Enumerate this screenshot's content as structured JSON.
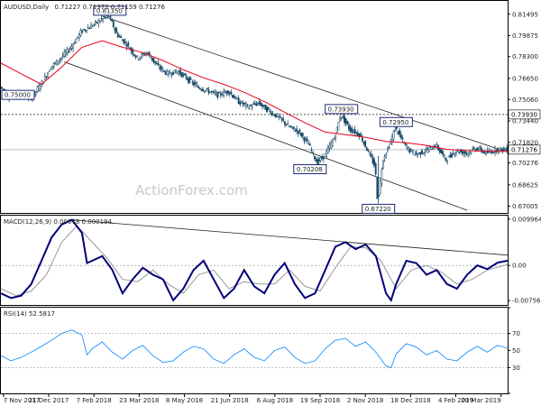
{
  "chart_data": [
    {
      "type": "candlestick",
      "panel": "price",
      "title": "AUDUSD,Daily",
      "ohlc_header": "0.71227 0.71372 0.71159 0.71276",
      "ylim": [
        0.665,
        0.825
      ],
      "y_ticks": [
        "0.81495",
        "0.79875",
        "0.78300",
        "0.76650",
        "0.75060",
        "0.73440",
        "0.71820",
        "0.70276",
        "0.68625",
        "0.67005"
      ],
      "y_tick_values": [
        0.81495,
        0.79875,
        0.783,
        0.7665,
        0.7506,
        0.7344,
        0.7182,
        0.70276,
        0.68625,
        0.67005
      ],
      "current_price": "0.71276",
      "current_price_value": 0.71276,
      "level_price": "0.73930",
      "level_price_value": 0.7393,
      "annotations": [
        {
          "text": "0.81350",
          "t": 0.215,
          "v": 0.8135
        },
        {
          "text": "0.75000",
          "t": 0.02,
          "v": 0.75
        },
        {
          "text": "0.73930",
          "t": 0.672,
          "v": 0.7393
        },
        {
          "text": "0.72950",
          "t": 0.78,
          "v": 0.7295
        },
        {
          "text": "0.70208",
          "t": 0.61,
          "v": 0.70208
        },
        {
          "text": "0.67220",
          "t": 0.745,
          "v": 0.6722
        }
      ],
      "price_path": [
        [
          0.0,
          0.76
        ],
        [
          0.02,
          0.752
        ],
        [
          0.04,
          0.756
        ],
        [
          0.06,
          0.751
        ],
        [
          0.08,
          0.762
        ],
        [
          0.1,
          0.775
        ],
        [
          0.12,
          0.782
        ],
        [
          0.14,
          0.79
        ],
        [
          0.16,
          0.802
        ],
        [
          0.18,
          0.806
        ],
        [
          0.2,
          0.811
        ],
        [
          0.215,
          0.8135
        ],
        [
          0.23,
          0.8
        ],
        [
          0.25,
          0.792
        ],
        [
          0.27,
          0.782
        ],
        [
          0.29,
          0.786
        ],
        [
          0.31,
          0.776
        ],
        [
          0.33,
          0.77
        ],
        [
          0.35,
          0.772
        ],
        [
          0.37,
          0.766
        ],
        [
          0.39,
          0.76
        ],
        [
          0.41,
          0.757
        ],
        [
          0.43,
          0.754
        ],
        [
          0.45,
          0.757
        ],
        [
          0.47,
          0.749
        ],
        [
          0.49,
          0.745
        ],
        [
          0.51,
          0.748
        ],
        [
          0.53,
          0.742
        ],
        [
          0.55,
          0.737
        ],
        [
          0.57,
          0.73
        ],
        [
          0.59,
          0.726
        ],
        [
          0.61,
          0.716
        ],
        [
          0.625,
          0.703
        ],
        [
          0.64,
          0.708
        ],
        [
          0.66,
          0.722
        ],
        [
          0.672,
          0.7393
        ],
        [
          0.69,
          0.728
        ],
        [
          0.71,
          0.724
        ],
        [
          0.725,
          0.712
        ],
        [
          0.74,
          0.7
        ],
        [
          0.745,
          0.6722
        ],
        [
          0.755,
          0.705
        ],
        [
          0.77,
          0.718
        ],
        [
          0.78,
          0.7295
        ],
        [
          0.8,
          0.715
        ],
        [
          0.82,
          0.709
        ],
        [
          0.84,
          0.712
        ],
        [
          0.86,
          0.716
        ],
        [
          0.88,
          0.705
        ],
        [
          0.9,
          0.712
        ],
        [
          0.92,
          0.71
        ],
        [
          0.94,
          0.714
        ],
        [
          0.96,
          0.71
        ],
        [
          0.98,
          0.713
        ],
        [
          1.0,
          0.71276
        ]
      ],
      "ma_path": [
        [
          0.0,
          0.778
        ],
        [
          0.04,
          0.77
        ],
        [
          0.08,
          0.762
        ],
        [
          0.12,
          0.775
        ],
        [
          0.16,
          0.79
        ],
        [
          0.2,
          0.795
        ],
        [
          0.24,
          0.79
        ],
        [
          0.28,
          0.786
        ],
        [
          0.32,
          0.78
        ],
        [
          0.36,
          0.773
        ],
        [
          0.4,
          0.767
        ],
        [
          0.44,
          0.762
        ],
        [
          0.48,
          0.756
        ],
        [
          0.52,
          0.749
        ],
        [
          0.56,
          0.741
        ],
        [
          0.6,
          0.733
        ],
        [
          0.64,
          0.726
        ],
        [
          0.68,
          0.724
        ],
        [
          0.72,
          0.722
        ],
        [
          0.76,
          0.719
        ],
        [
          0.8,
          0.718
        ],
        [
          0.84,
          0.716
        ],
        [
          0.88,
          0.713
        ],
        [
          0.92,
          0.712
        ],
        [
          0.96,
          0.7115
        ],
        [
          1.0,
          0.7115
        ]
      ],
      "channel_upper": [
        [
          0.2,
          0.8135
        ],
        [
          0.995,
          0.7115
        ]
      ],
      "channel_lower": [
        [
          0.125,
          0.779
        ],
        [
          0.92,
          0.667
        ]
      ]
    },
    {
      "type": "line",
      "panel": "macd",
      "title": "MACD(12,26,9) 0.00078 0.000194",
      "ylim": [
        -0.0085,
        0.0107
      ],
      "y_ticks": [
        "0.009964",
        "0.00",
        "-0.00756"
      ],
      "y_tick_values": [
        0.009964,
        0.0,
        -0.00756
      ],
      "series": [
        {
          "name": "",
          "color": "#00007a",
          "path": [
            [
              0.0,
              -0.006
            ],
            [
              0.02,
              -0.007
            ],
            [
              0.04,
              -0.0065
            ],
            [
              0.06,
              -0.004
            ],
            [
              0.08,
              0.001
            ],
            [
              0.1,
              0.006
            ],
            [
              0.12,
              0.0088
            ],
            [
              0.14,
              0.0098
            ],
            [
              0.16,
              0.007
            ],
            [
              0.17,
              0.0005
            ],
            [
              0.18,
              0.001
            ],
            [
              0.2,
              0.002
            ],
            [
              0.22,
              -0.001
            ],
            [
              0.24,
              -0.006
            ],
            [
              0.26,
              -0.003
            ],
            [
              0.28,
              -0.0005
            ],
            [
              0.3,
              -0.002
            ],
            [
              0.32,
              -0.003
            ],
            [
              0.34,
              -0.0075
            ],
            [
              0.36,
              -0.005
            ],
            [
              0.38,
              -0.001
            ],
            [
              0.4,
              0.001
            ],
            [
              0.42,
              -0.003
            ],
            [
              0.44,
              -0.007
            ],
            [
              0.46,
              -0.005
            ],
            [
              0.48,
              -0.001
            ],
            [
              0.5,
              -0.0045
            ],
            [
              0.52,
              -0.006
            ],
            [
              0.54,
              -0.002
            ],
            [
              0.56,
              0.0005
            ],
            [
              0.58,
              -0.004
            ],
            [
              0.6,
              -0.007
            ],
            [
              0.62,
              -0.006
            ],
            [
              0.64,
              -0.001
            ],
            [
              0.66,
              0.004
            ],
            [
              0.68,
              0.005
            ],
            [
              0.7,
              0.0035
            ],
            [
              0.72,
              0.0045
            ],
            [
              0.74,
              0.002
            ],
            [
              0.76,
              -0.006
            ],
            [
              0.77,
              -0.0075
            ],
            [
              0.78,
              -0.004
            ],
            [
              0.8,
              0.001
            ],
            [
              0.82,
              0.0005
            ],
            [
              0.84,
              -0.002
            ],
            [
              0.86,
              -0.001
            ],
            [
              0.88,
              -0.004
            ],
            [
              0.9,
              -0.005
            ],
            [
              0.92,
              -0.002
            ],
            [
              0.94,
              0.0
            ],
            [
              0.96,
              -0.0008
            ],
            [
              0.98,
              0.0006
            ],
            [
              1.0,
              0.001
            ]
          ]
        },
        {
          "name": "",
          "color": "#999999",
          "path": [
            [
              0.0,
              -0.005
            ],
            [
              0.03,
              -0.0065
            ],
            [
              0.06,
              -0.0055
            ],
            [
              0.09,
              -0.002
            ],
            [
              0.12,
              0.005
            ],
            [
              0.15,
              0.0085
            ],
            [
              0.18,
              0.005
            ],
            [
              0.21,
              0.0015
            ],
            [
              0.24,
              -0.003
            ],
            [
              0.27,
              -0.0035
            ],
            [
              0.3,
              -0.001
            ],
            [
              0.33,
              -0.004
            ],
            [
              0.36,
              -0.006
            ],
            [
              0.39,
              -0.002
            ],
            [
              0.42,
              -0.001
            ],
            [
              0.45,
              -0.005
            ],
            [
              0.48,
              -0.0035
            ],
            [
              0.51,
              -0.004
            ],
            [
              0.54,
              -0.004
            ],
            [
              0.57,
              -0.001
            ],
            [
              0.6,
              -0.0045
            ],
            [
              0.63,
              -0.0055
            ],
            [
              0.66,
              -0.0005
            ],
            [
              0.69,
              0.004
            ],
            [
              0.72,
              0.0038
            ],
            [
              0.75,
              0.001
            ],
            [
              0.78,
              -0.005
            ],
            [
              0.81,
              -0.001
            ],
            [
              0.84,
              0.0
            ],
            [
              0.87,
              -0.0015
            ],
            [
              0.9,
              -0.004
            ],
            [
              0.93,
              -0.003
            ],
            [
              0.96,
              -0.001
            ],
            [
              1.0,
              0.0002
            ]
          ]
        }
      ],
      "trendline": [
        [
          0.14,
          0.0098
        ],
        [
          1.0,
          0.0022
        ]
      ]
    },
    {
      "type": "line",
      "panel": "rsi",
      "title": "RSI(14) 52.5817",
      "ylim": [
        0,
        100
      ],
      "y_ticks": [
        "100",
        "70",
        "50",
        "30",
        "0"
      ],
      "y_tick_values": [
        100,
        70,
        50,
        30,
        0
      ],
      "series": [
        {
          "name": "",
          "color": "#1e90ff",
          "path": [
            [
              0.0,
              44
            ],
            [
              0.02,
              38
            ],
            [
              0.04,
              42
            ],
            [
              0.06,
              48
            ],
            [
              0.08,
              55
            ],
            [
              0.1,
              62
            ],
            [
              0.12,
              70
            ],
            [
              0.14,
              74
            ],
            [
              0.16,
              68
            ],
            [
              0.17,
              45
            ],
            [
              0.18,
              52
            ],
            [
              0.2,
              60
            ],
            [
              0.22,
              48
            ],
            [
              0.24,
              40
            ],
            [
              0.26,
              50
            ],
            [
              0.28,
              56
            ],
            [
              0.3,
              44
            ],
            [
              0.32,
              36
            ],
            [
              0.34,
              38
            ],
            [
              0.36,
              48
            ],
            [
              0.38,
              55
            ],
            [
              0.4,
              52
            ],
            [
              0.42,
              40
            ],
            [
              0.44,
              35
            ],
            [
              0.46,
              45
            ],
            [
              0.48,
              52
            ],
            [
              0.5,
              42
            ],
            [
              0.52,
              38
            ],
            [
              0.54,
              50
            ],
            [
              0.56,
              54
            ],
            [
              0.58,
              42
            ],
            [
              0.6,
              35
            ],
            [
              0.62,
              38
            ],
            [
              0.64,
              52
            ],
            [
              0.66,
              62
            ],
            [
              0.68,
              64
            ],
            [
              0.7,
              55
            ],
            [
              0.72,
              60
            ],
            [
              0.74,
              48
            ],
            [
              0.76,
              32
            ],
            [
              0.77,
              30
            ],
            [
              0.78,
              46
            ],
            [
              0.8,
              58
            ],
            [
              0.82,
              54
            ],
            [
              0.84,
              45
            ],
            [
              0.86,
              50
            ],
            [
              0.88,
              40
            ],
            [
              0.9,
              38
            ],
            [
              0.92,
              48
            ],
            [
              0.94,
              55
            ],
            [
              0.96,
              48
            ],
            [
              0.98,
              56
            ],
            [
              1.0,
              52.58
            ]
          ]
        }
      ]
    }
  ],
  "x_ticks": [
    "7 Nov 2017",
    "21 Dec 2017",
    "7 Feb 2018",
    "23 Mar 2018",
    "8 May 2018",
    "21 Jun 2018",
    "6 Aug 2018",
    "19 Sep 2018",
    "2 Nov 2018",
    "18 Dec 2018",
    "4 Feb 2019",
    "20 Mar 2019"
  ],
  "watermark": "ActionForex.com",
  "colors": {
    "candle": "#1a4a66",
    "ma": "#e8001c",
    "channel": "#222222",
    "dotted_level": "#555555",
    "current_price_line": "#bfbfbf",
    "box_border": "#1f2a77"
  }
}
